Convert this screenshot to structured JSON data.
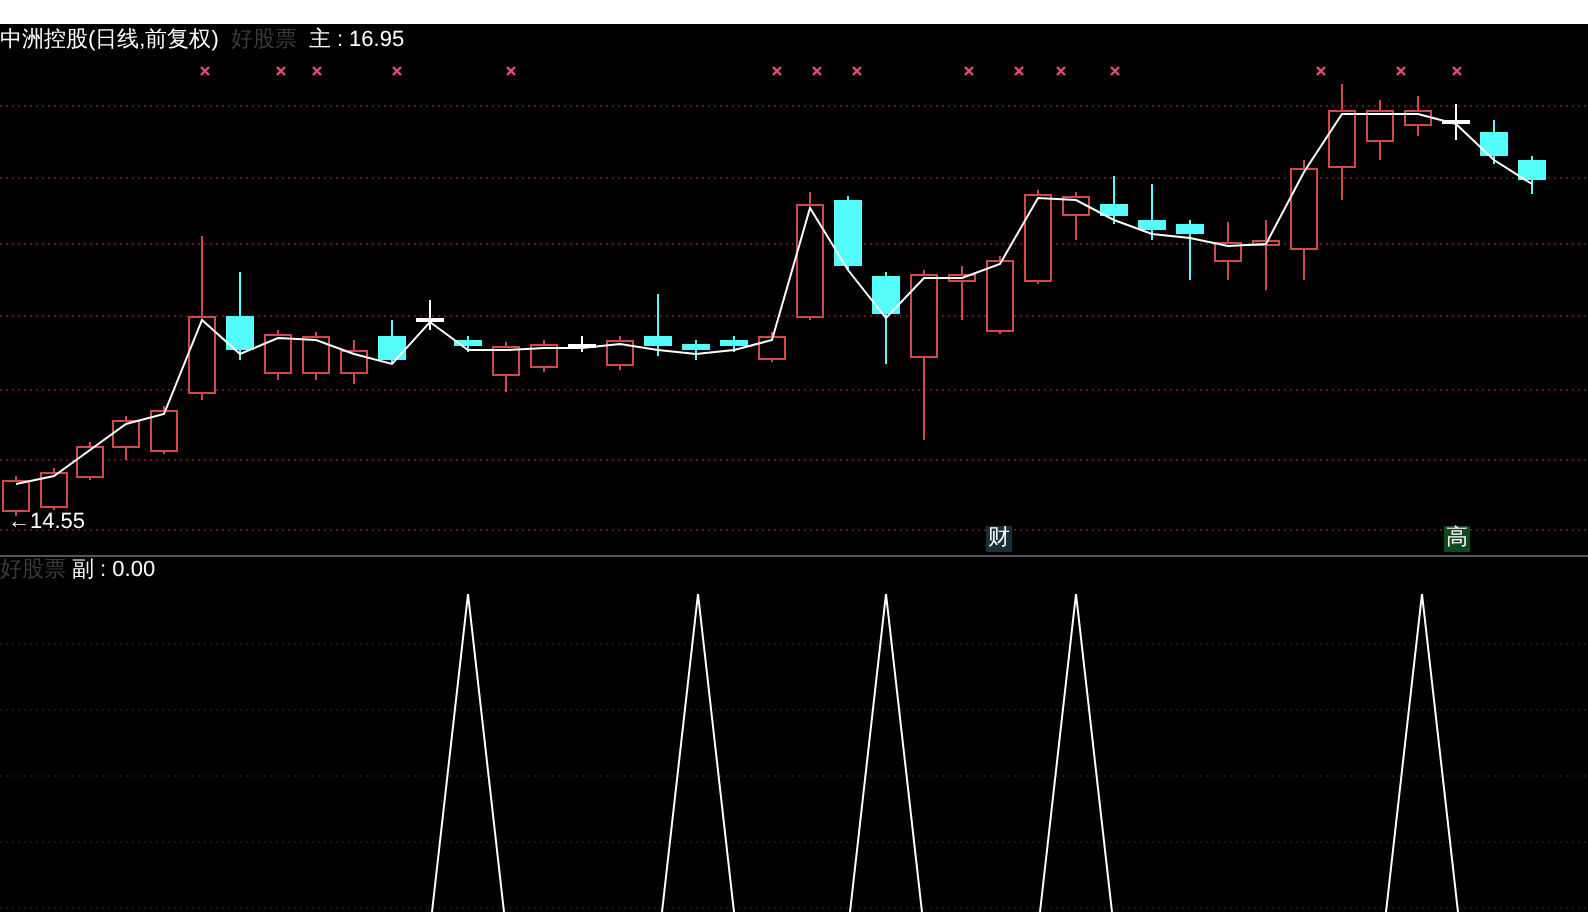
{
  "main_panel": {
    "title": "中洲控股(日线,前复权)",
    "faint_label": "好股票",
    "reading": "主 : 16.95",
    "low_marker": "←14.55",
    "events": [
      {
        "label": "财",
        "color": "#1a3038"
      },
      {
        "label": "高",
        "color": "#0f4a1e"
      }
    ]
  },
  "sub_panel": {
    "faint_label": "好股票",
    "reading": "副 : 0.00"
  }
}
